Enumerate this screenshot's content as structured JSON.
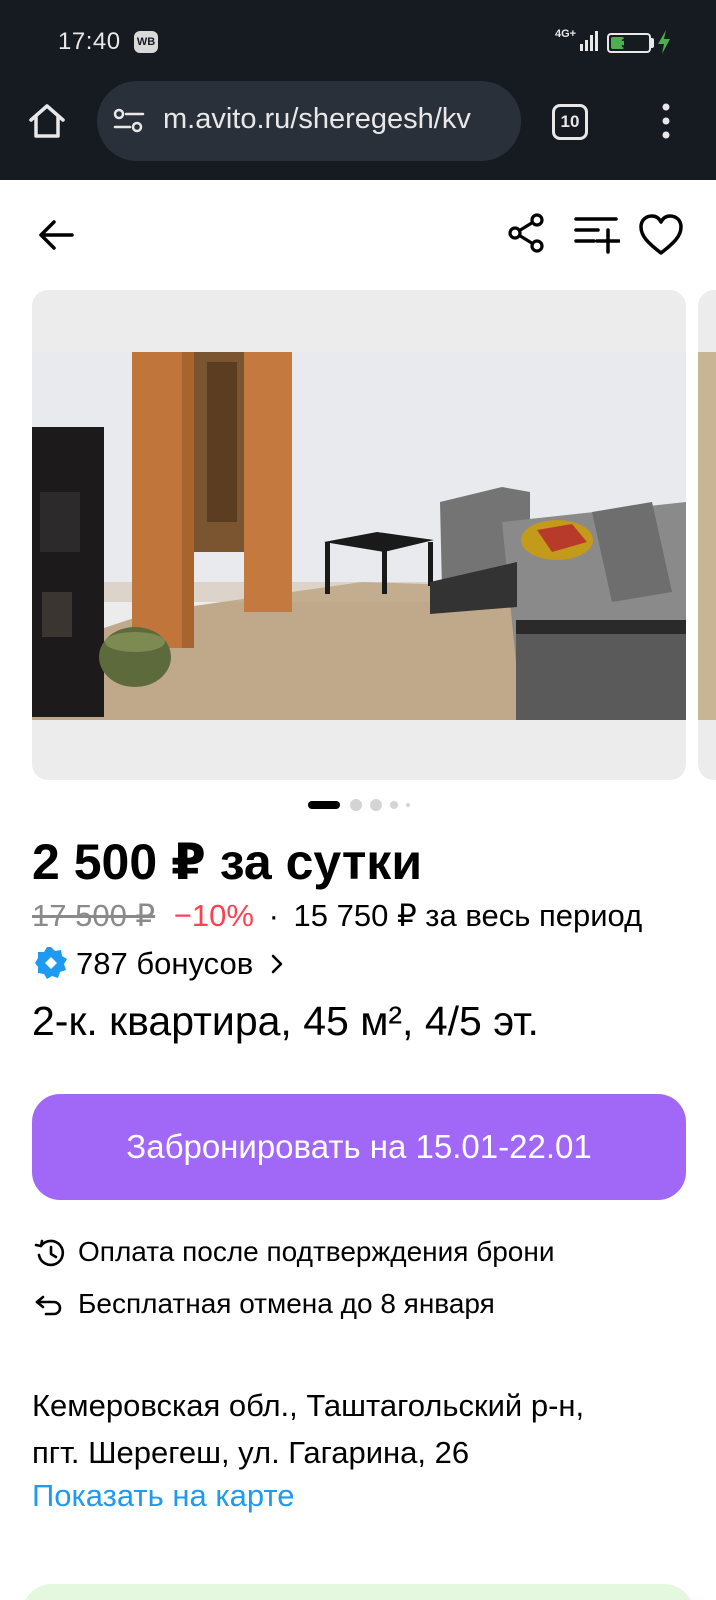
{
  "status_bar": {
    "time": "17:40",
    "app_badge": "WB",
    "network": "4G+",
    "battery": "37",
    "battery_level_percent": 37
  },
  "browser": {
    "url": "m.avito.ru/sheregesh/kv",
    "tab_count": "10"
  },
  "listing": {
    "gallery": {
      "total_photos": 5,
      "active_index": 0
    },
    "price": "2 500 ₽ за сутки",
    "old_price": "17 500 ₽",
    "discount": "−10%",
    "separator": "·",
    "total_price": "15 750 ₽ за весь период",
    "bonus": "787 бонусов",
    "title": "2-к. квартира, 45 м², 4/5 эт.",
    "book_button": "Забронировать на 15.01-22.01",
    "conditions": [
      {
        "icon": "payment-after-confirm-icon",
        "text": "Оплата после подтверждения брони"
      },
      {
        "icon": "free-cancel-icon",
        "text": "Бесплатная отмена до 8 января"
      }
    ],
    "address_line1": "Кемеровская обл., Таштагольский р-н,",
    "address_line2": "пгт. Шерегеш, ул. Гагарина, 26",
    "map_link": "Показать на карте"
  },
  "colors": {
    "chrome_bg": "#161b22",
    "accent_purple": "#a168f7",
    "discount_red": "#ff4053",
    "link_blue": "#1e9bf0",
    "bonus_blue": "#1e9bf0",
    "battery_green": "#4caf50"
  }
}
